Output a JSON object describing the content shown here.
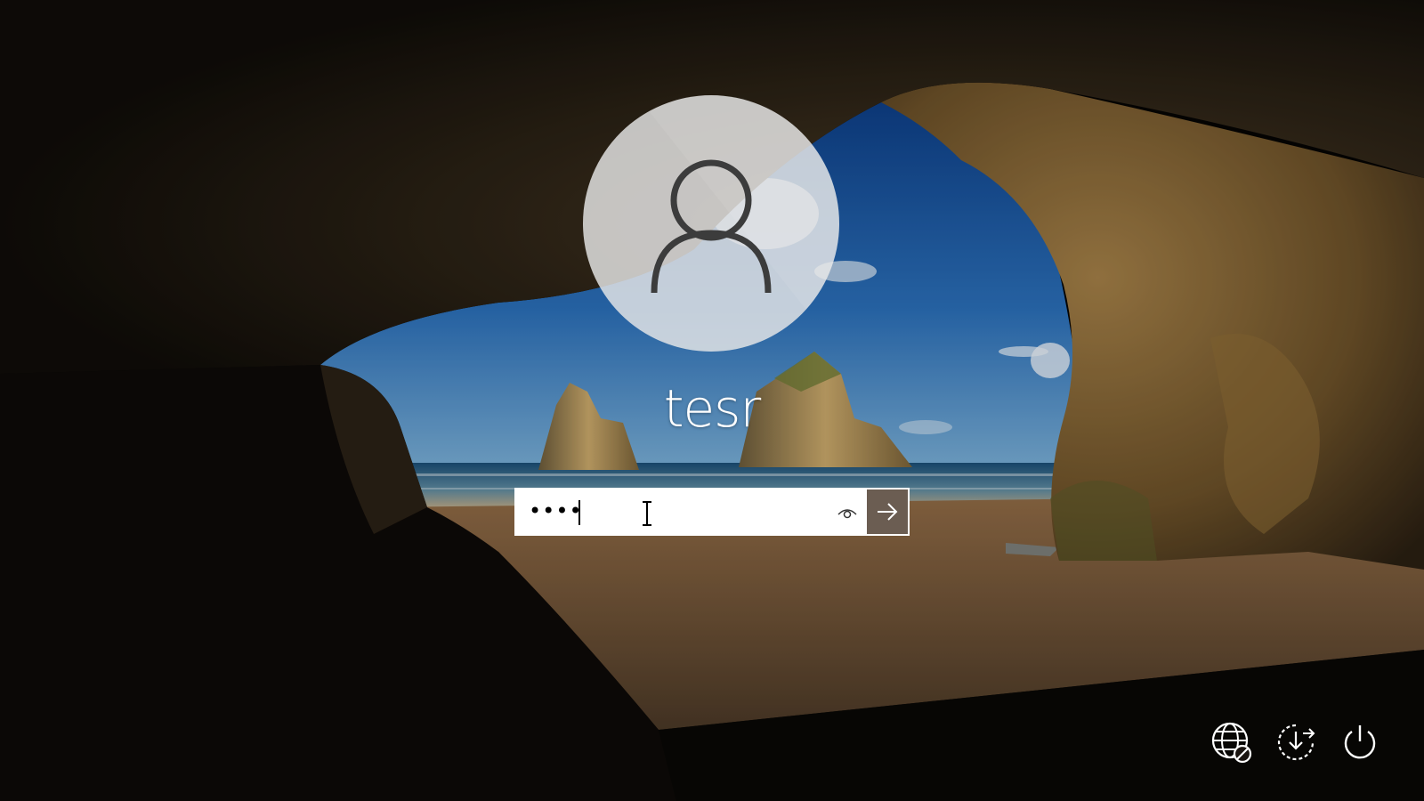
{
  "login": {
    "username": "tesr",
    "password_masked": "••••",
    "password_length": 4
  },
  "icons": {
    "avatar": "user-silhouette-icon",
    "reveal": "eye-icon",
    "submit": "arrow-right-icon",
    "network": "network-globe-icon",
    "accessibility": "ease-of-access-icon",
    "power": "power-icon",
    "cursor": "text-ibeam-cursor"
  },
  "colors": {
    "submit_bg": "#6b5d52",
    "text": "#ffffff",
    "field_bg": "#ffffff"
  }
}
